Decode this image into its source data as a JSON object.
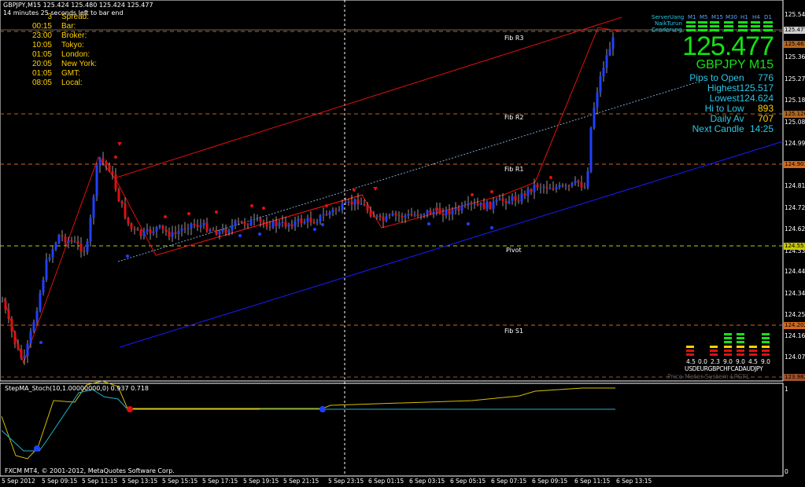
{
  "header": {
    "symbol_line": "GBPJPY,M15  125.424 125.480 125.424 125.477",
    "countdown": "14 minutes 25 seconds left to bar end"
  },
  "clock_panel": [
    {
      "time": "3",
      "label": "Spread:"
    },
    {
      "time": "00:15",
      "label": "Bar:"
    },
    {
      "time": "23:00",
      "label": "Broker:"
    },
    {
      "time": "10:05",
      "label": "Tokyo:"
    },
    {
      "time": "01:05",
      "label": "London:"
    },
    {
      "time": "20:05",
      "label": "New York:"
    },
    {
      "time": "01:05",
      "label": "GMT:"
    },
    {
      "time": "08:05",
      "label": "Local:"
    }
  ],
  "signal_panel": {
    "rows": [
      "ServerUang",
      "NaikTurun",
      "Cenderung"
    ],
    "timeframes": [
      "M1",
      "M5",
      "M15",
      "M30",
      "H1",
      "H4",
      "D1"
    ]
  },
  "price_panel": {
    "price": "125.477",
    "pair": "GBPJPY M15",
    "stats": [
      {
        "label": "Pips to Open",
        "value": "776",
        "color": "#28c8e6"
      },
      {
        "label": "Highest",
        "value": "125.517",
        "color": "#28c8e6"
      },
      {
        "label": "Lowest",
        "value": "124.624",
        "color": "#28c8e6"
      },
      {
        "label": "Hi to Low",
        "value": "893",
        "color": "#ffd000"
      },
      {
        "label": "Daily Av",
        "value": "707",
        "color": "#ffd000"
      },
      {
        "label": "Next Candle",
        "value": "14:25",
        "color": "#28c8e6"
      }
    ]
  },
  "price_axis": [
    "125.545",
    "125.365",
    "125.270",
    "125.180",
    "125.085",
    "124.995",
    "124.815",
    "124.720",
    "124.625",
    "124.530",
    "124.440",
    "124.345",
    "124.255",
    "124.165",
    "124.070"
  ],
  "price_tags": [
    {
      "text": "125.477",
      "color": "#cfcfcf"
    },
    {
      "text": "125.461",
      "color": "#b5651d"
    },
    {
      "text": "125.120",
      "color": "#b5651d"
    },
    {
      "text": "124.901",
      "color": "#d2691e"
    },
    {
      "text": "124.551",
      "color": "#c8c800"
    },
    {
      "text": "124.202",
      "color": "#d2691e"
    },
    {
      "text": "123.982",
      "color": "#a0522d"
    }
  ],
  "pivot_labels": [
    "Fib R3",
    "Fib R2",
    "Fib R1",
    "Pivot",
    "Fib S1"
  ],
  "meter": {
    "values": [
      "4.5",
      "0.0",
      "2.3",
      "9.0",
      "9.0",
      "4.5",
      "9.0"
    ],
    "currencies": "USDEURGBPCHFCADAUDJPY",
    "watermark": "Price Meter System LPGFL"
  },
  "indicator": {
    "title": "StepMA_Stoch(10,1.00000000,0) 0.937 0.718",
    "axis": [
      "1",
      "0"
    ]
  },
  "copyright": "FXCM MT4, © 2001-2012, MetaQuotes Software Corp.",
  "time_axis": [
    "5 Sep 2012",
    "5 Sep 09:15",
    "5 Sep 11:15",
    "5 Sep 13:15",
    "5 Sep 15:15",
    "5 Sep 17:15",
    "5 Sep 19:15",
    "5 Sep 21:15",
    "5 Sep 23:15",
    "6 Sep 01:15",
    "6 Sep 03:15",
    "6 Sep 05:15",
    "6 Sep 07:15",
    "6 Sep 09:15",
    "6 Sep 11:15",
    "6 Sep 13:15"
  ]
}
